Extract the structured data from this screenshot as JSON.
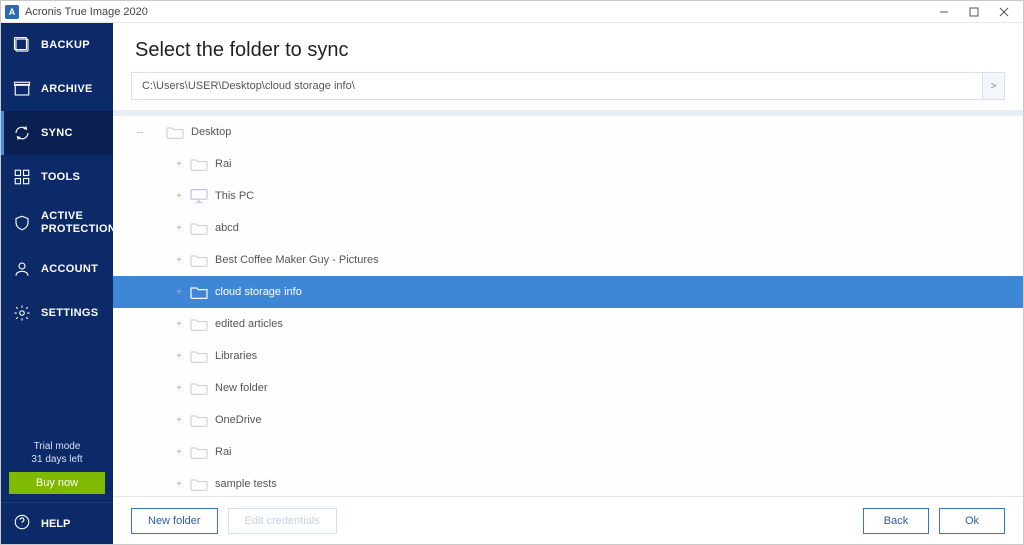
{
  "titlebar": {
    "app_letter": "A",
    "title": "Acronis True Image 2020"
  },
  "sidebar": {
    "items": [
      {
        "label": "BACKUP"
      },
      {
        "label": "ARCHIVE"
      },
      {
        "label": "SYNC"
      },
      {
        "label": "TOOLS"
      },
      {
        "label": "ACTIVE PROTECTION"
      },
      {
        "label": "ACCOUNT"
      },
      {
        "label": "SETTINGS"
      }
    ],
    "trial_line1": "Trial mode",
    "trial_line2": "31 days left",
    "buy_label": "Buy now",
    "help_label": "HELP"
  },
  "main": {
    "heading": "Select the folder to sync",
    "path_value": "C:\\Users\\USER\\Desktop\\cloud storage info\\",
    "go_glyph": ">",
    "tree": {
      "root_label": "Desktop",
      "children": [
        {
          "label": "Rai",
          "kind": "folder"
        },
        {
          "label": "This PC",
          "kind": "pc"
        },
        {
          "label": "abcd",
          "kind": "folder"
        },
        {
          "label": "Best Coffee Maker Guy - Pictures",
          "kind": "folder"
        },
        {
          "label": "cloud storage info",
          "kind": "folder",
          "selected": true
        },
        {
          "label": "edited articles",
          "kind": "folder"
        },
        {
          "label": "Libraries",
          "kind": "folder"
        },
        {
          "label": "New folder",
          "kind": "folder"
        },
        {
          "label": "OneDrive",
          "kind": "folder"
        },
        {
          "label": "Rai",
          "kind": "folder"
        },
        {
          "label": "sample tests",
          "kind": "folder"
        }
      ]
    }
  },
  "footer": {
    "new_folder": "New folder",
    "edit_credentials": "Edit credentials",
    "back": "Back",
    "ok": "Ok"
  }
}
